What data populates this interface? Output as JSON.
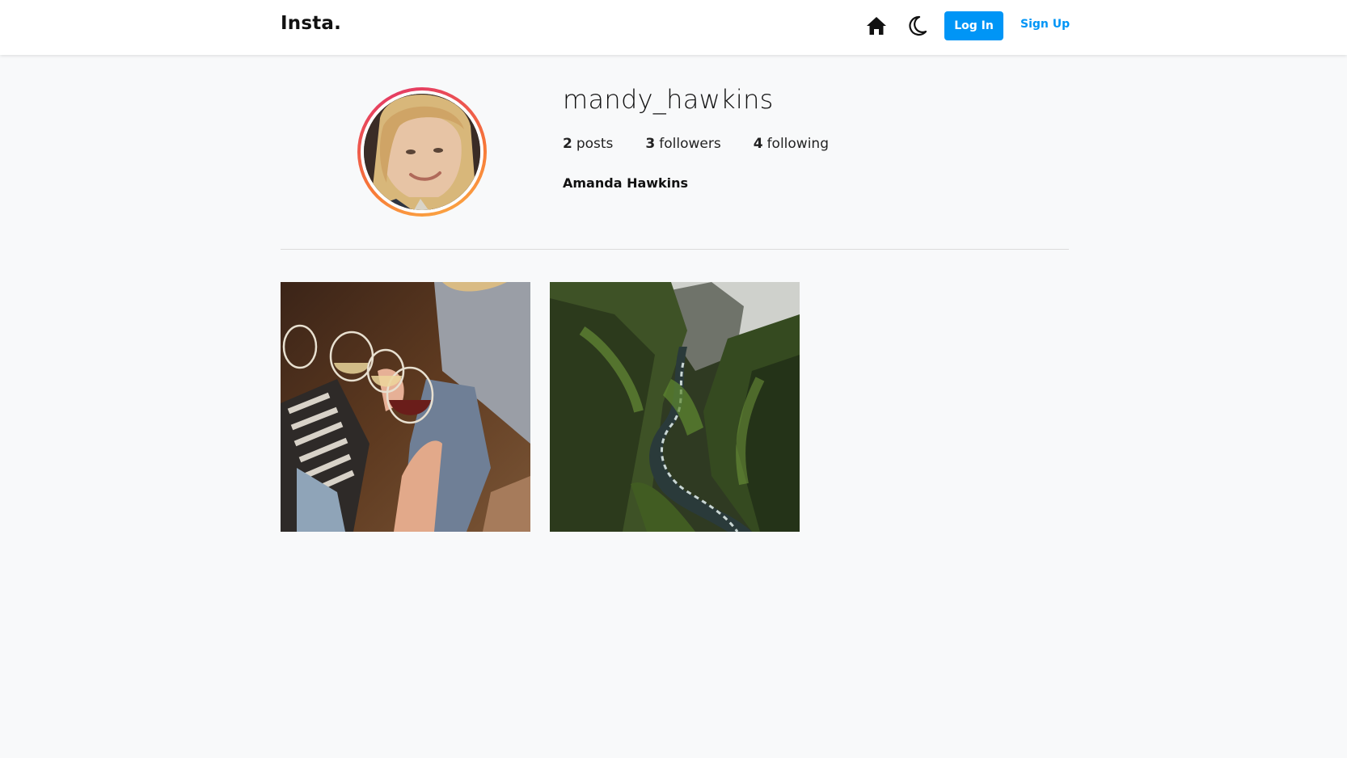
{
  "header": {
    "logo": "Insta.",
    "home_icon": "home-icon",
    "theme_icon": "moon-icon",
    "login_label": "Log In",
    "signup_label": "Sign Up",
    "accent_color": "#0095f6"
  },
  "profile": {
    "username": "mandy_hawkins",
    "full_name": "Amanda Hawkins",
    "stats": [
      {
        "count": "2",
        "label": "posts"
      },
      {
        "count": "3",
        "label": "followers"
      },
      {
        "count": "4",
        "label": "following"
      }
    ],
    "avatar_ring_colors": [
      "#e1306c",
      "#f77737",
      "#fcaf45"
    ]
  },
  "posts": [
    {
      "subject": "friends toasting wine glasses"
    },
    {
      "subject": "green mossy canyon with river"
    }
  ]
}
